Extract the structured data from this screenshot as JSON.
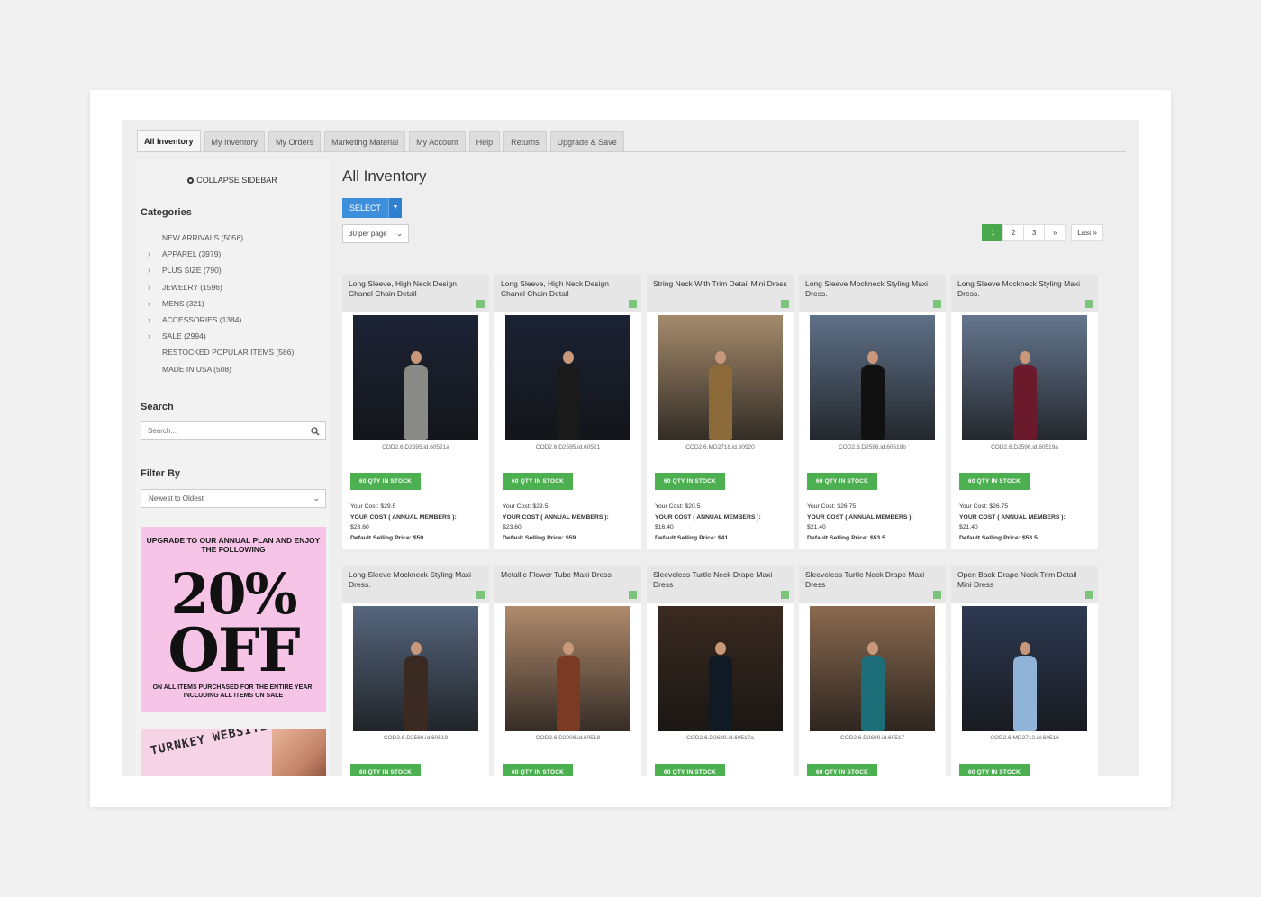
{
  "tabs": [
    "All Inventory",
    "My Inventory",
    "My Orders",
    "Marketing Material",
    "My Account",
    "Help",
    "Returns",
    "Upgrade & Save"
  ],
  "sidebar": {
    "collapse_label": "COLLAPSE SIDEBAR",
    "categories_heading": "Categories",
    "categories": [
      {
        "label": "NEW ARRIVALS (5056)",
        "chevron": false
      },
      {
        "label": "APPAREL (3979)",
        "chevron": true
      },
      {
        "label": "PLUS SIZE (790)",
        "chevron": true
      },
      {
        "label": "JEWELRY (1596)",
        "chevron": true
      },
      {
        "label": "MENS (321)",
        "chevron": true
      },
      {
        "label": "ACCESSORIES (1384)",
        "chevron": true
      },
      {
        "label": "SALE (2994)",
        "chevron": true
      },
      {
        "label": "RESTOCKED POPULAR ITEMS (586)",
        "chevron": false
      },
      {
        "label": "MADE IN USA (508)",
        "chevron": false
      }
    ],
    "search_heading": "Search",
    "search_placeholder": "Search...",
    "filter_heading": "Filter By",
    "filter_value": "Newest to Oldest",
    "promo1": {
      "top_text": "UPGRADE TO OUR ANNUAL PLAN AND ENJOY THE FOLLOWING",
      "big1": "20%",
      "big2": "OFF",
      "bottom_text": "ON ALL ITEMS PURCHASED FOR THE ENTIRE YEAR, INCLUDING ALL ITEMS ON SALE"
    },
    "promo2": {
      "text": "TURNKEY WEBSITE OFFER"
    }
  },
  "main": {
    "title": "All Inventory",
    "select_label": "SELECT",
    "per_page": "30 per page",
    "pagination": [
      "1",
      "2",
      "3",
      "»",
      "Last »"
    ]
  },
  "stock_label": "60 QTY IN STOCK",
  "products": [
    {
      "title": "Long Sleeve, High Neck Design Chanel Chain Detail",
      "sku": "COD2.6.D2595.id.60521a",
      "your_cost": "Your Cost: $29.5",
      "annual_label": "YOUR COST ( ANNUAL MEMBERS ):",
      "annual_price": "$23.60",
      "default_price": "Default Selling Price: $59",
      "bg": "#1d2436",
      "dress": "#8a8a86"
    },
    {
      "title": "Long Sleeve, High Neck Design Chanel Chain Detail",
      "sku": "COD2.6.D2595.id.60521",
      "your_cost": "Your Cost: $29.5",
      "annual_label": "YOUR COST ( ANNUAL MEMBERS ):",
      "annual_price": "$23.60",
      "default_price": "Default Selling Price: $59",
      "bg": "#1b2233",
      "dress": "#1a1a1a"
    },
    {
      "title": "String Neck With Trim Detail Mini Dress",
      "sku": "COD2.6.MD2718.id.60520",
      "your_cost": "Your Cost: $20.5",
      "annual_label": "YOUR COST ( ANNUAL MEMBERS ):",
      "annual_price": "$16.40",
      "default_price": "Default Selling Price: $41",
      "bg": "#a48a6c",
      "dress": "#8d6a3a"
    },
    {
      "title": "Long Sleeve Mockneck Styling Maxi Dress.",
      "sku": "COD2.6.D2596.id.60519b",
      "your_cost": "Your Cost: $26.75",
      "annual_label": "YOUR COST ( ANNUAL MEMBERS ):",
      "annual_price": "$21.40",
      "default_price": "Default Selling Price: $53.5",
      "bg": "#5f7188",
      "dress": "#111111"
    },
    {
      "title": "Long Sleeve Mockneck Styling Maxi Dress.",
      "sku": "COD2.6.D2596.id.60519a",
      "your_cost": "Your Cost: $26.75",
      "annual_label": "YOUR COST ( ANNUAL MEMBERS ):",
      "annual_price": "$21.40",
      "default_price": "Default Selling Price: $53.5",
      "bg": "#65768e",
      "dress": "#6a1a2a"
    },
    {
      "title": "Long Sleeve Mockneck Styling Maxi Dress.",
      "sku": "COD2.6.D2586.id.60519",
      "bg": "#56667c",
      "dress": "#3a2a22"
    },
    {
      "title": "Metallic Flower Tube Maxi Dress",
      "sku": "COD2.6.D2008.id.60518",
      "bg": "#b08a6c",
      "dress": "#7a3a24"
    },
    {
      "title": "Sleeveless Turtle Neck Drape Maxi Dress",
      "sku": "COD2.6.D2689.id.60517a",
      "bg": "#3a2a20",
      "dress": "#0f1a24"
    },
    {
      "title": "Sleeveless Turtle Neck Drape Maxi Dress",
      "sku": "COD2.6.D2689.id.60517",
      "bg": "#8a6a50",
      "dress": "#1e6e7a"
    },
    {
      "title": "Open Back Drape Neck Trim Detail Mini Dress",
      "sku": "COD2.6.MD2712.id.60516",
      "bg": "#2e3a52",
      "dress": "#8fb4d8"
    }
  ]
}
